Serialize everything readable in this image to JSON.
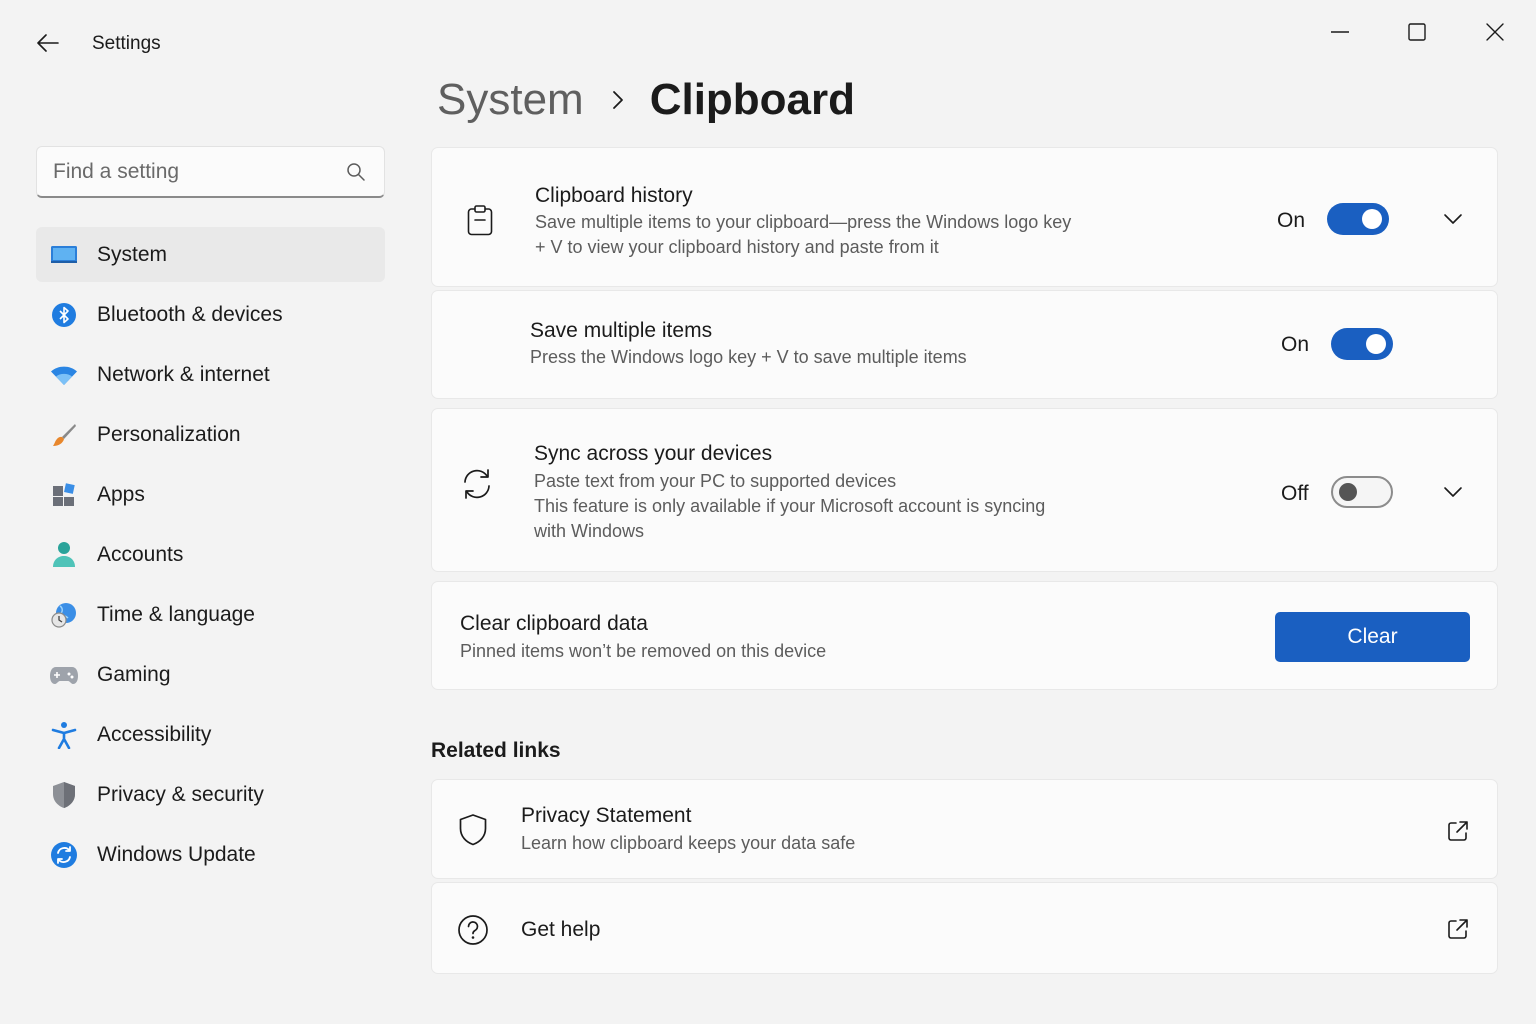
{
  "window": {
    "title": "Settings",
    "controls": [
      "minimize",
      "maximize",
      "close"
    ]
  },
  "sidebar": {
    "search_placeholder": "Find a setting",
    "items": [
      {
        "label": "System",
        "icon": "system-monitor-icon",
        "active": true
      },
      {
        "label": "Bluetooth & devices",
        "icon": "bluetooth-icon"
      },
      {
        "label": "Network & internet",
        "icon": "wifi-icon"
      },
      {
        "label": "Personalization",
        "icon": "paintbrush-icon"
      },
      {
        "label": "Apps",
        "icon": "apps-icon"
      },
      {
        "label": "Accounts",
        "icon": "person-icon"
      },
      {
        "label": "Time & language",
        "icon": "clock-globe-icon"
      },
      {
        "label": "Gaming",
        "icon": "gamepad-icon"
      },
      {
        "label": "Accessibility",
        "icon": "accessibility-icon"
      },
      {
        "label": "Privacy & security",
        "icon": "shield-icon"
      },
      {
        "label": "Windows Update",
        "icon": "update-icon"
      }
    ]
  },
  "breadcrumb": {
    "parent": "System",
    "current": "Clipboard"
  },
  "settings": {
    "history": {
      "title": "Clipboard history",
      "desc_line1": "Save multiple items to your clipboard—press the Windows logo key",
      "desc_line2": "+ V to view your clipboard history and paste from it",
      "state": "On",
      "enabled": true
    },
    "save_multiple": {
      "title": "Save multiple items",
      "desc": "Press the Windows logo key + V to save multiple items",
      "state": "On",
      "enabled": true
    },
    "sync": {
      "title": "Sync across your devices",
      "desc_line1": "Paste text from your PC to supported devices",
      "desc_line2": "This feature is only available if your Microsoft account is syncing",
      "desc_line3": "with Windows",
      "state": "Off",
      "enabled": false
    },
    "clear": {
      "title": "Clear clipboard data",
      "desc": "Pinned items won’t be removed on this device",
      "button": "Clear"
    }
  },
  "related": {
    "title": "Related links",
    "privacy": {
      "title": "Privacy Statement",
      "desc": "Learn how clipboard keeps your data safe"
    },
    "help": {
      "title": "Get help"
    }
  },
  "colors": {
    "accent": "#1a5fc1",
    "background": "#f3f3f3",
    "card": "#fbfbfb"
  }
}
